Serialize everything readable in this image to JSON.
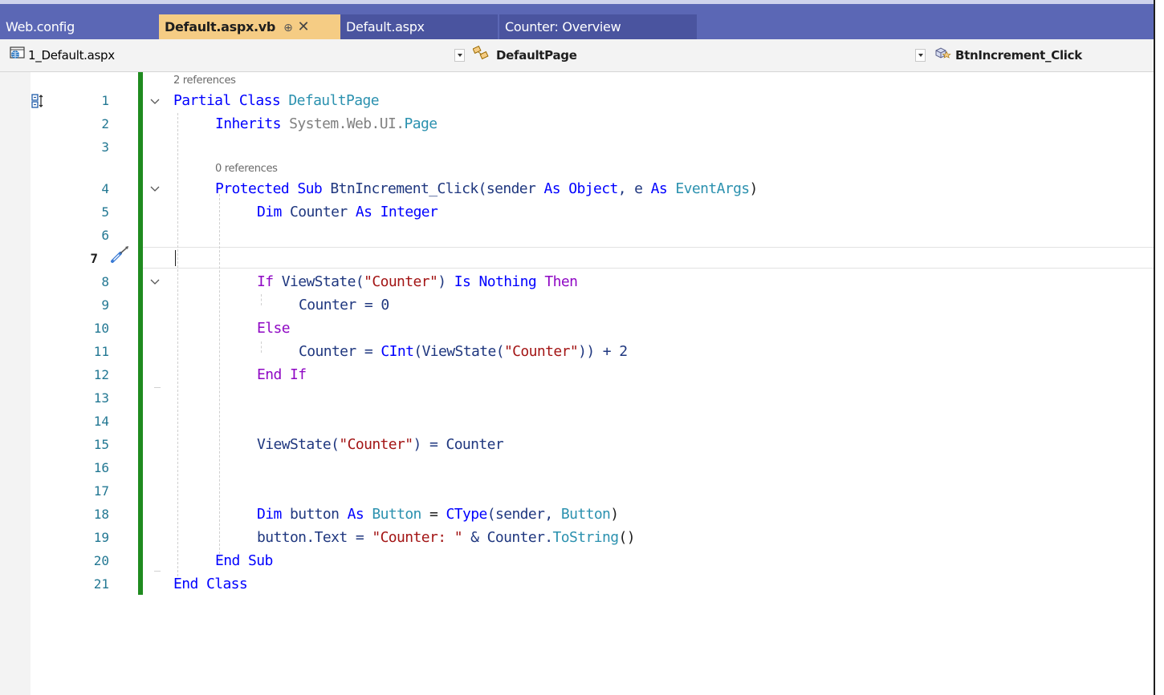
{
  "tabs": [
    {
      "label": "Web.config"
    },
    {
      "label": "Default.aspx.vb",
      "pin": "⊕",
      "close": "✕"
    },
    {
      "label": "Default.aspx"
    },
    {
      "label": "Counter: Overview"
    }
  ],
  "navbar": {
    "project": "1_Default.aspx",
    "class": "DefaultPage",
    "member": "BtnIncrement_Click"
  },
  "editor": {
    "current_line": "7",
    "codelens": {
      "class_refs": "2 references",
      "method_refs": "0 references"
    },
    "line_numbers": [
      "1",
      "2",
      "3",
      "4",
      "5",
      "6",
      "7",
      "8",
      "9",
      "10",
      "11",
      "12",
      "13",
      "14",
      "15",
      "16",
      "17",
      "18",
      "19",
      "20",
      "21"
    ],
    "lines": {
      "l1": {
        "kw1": "Partial",
        "kw2": "Class",
        "name": "DefaultPage"
      },
      "l2": {
        "kw": "Inherits",
        "ns": "System.Web.UI.",
        "type": "Page"
      },
      "l4": {
        "kw1": "Protected",
        "kw2": "Sub",
        "name": "BtnIncrement_Click(sender",
        "kw3": "As",
        "t1": "Object",
        "mid": ", e",
        "kw4": "As",
        "t2": "EventArgs",
        "end": ")"
      },
      "l5": {
        "kw1": "Dim",
        "name": "Counter",
        "kw2": "As",
        "type": "Integer"
      },
      "l8": {
        "kw1": "If",
        "expr": "ViewState(",
        "str": "\"Counter\"",
        "close": ")",
        "kw2": "Is",
        "kw3": "Nothing",
        "kw4": "Then"
      },
      "l9": {
        "text": "Counter = 0"
      },
      "l10": {
        "kw": "Else"
      },
      "l11": {
        "lhs": "Counter = ",
        "fn": "CInt",
        "mid": "(ViewState(",
        "str": "\"Counter\"",
        "end": ")) + 2"
      },
      "l12": {
        "kw1": "End",
        "kw2": "If"
      },
      "l15": {
        "lhs": "ViewState(",
        "str": "\"Counter\"",
        "end": ") = Counter"
      },
      "l18": {
        "kw1": "Dim",
        "name": "button",
        "kw2": "As",
        "t1": "Button",
        "eq": "=",
        "fn": "CType",
        "mid": "(sender, ",
        "t2": "Button",
        "end": ")"
      },
      "l19": {
        "lhs": "button.Text = ",
        "str": "\"Counter: \"",
        "amp": " & Counter.",
        "fn": "ToString",
        "end": "()"
      },
      "l20": {
        "kw1": "End",
        "kw2": "Sub"
      },
      "l21": {
        "kw1": "End",
        "kw2": "Class"
      }
    }
  },
  "colors": {
    "tabbar": "#5b67b5",
    "active_tab": "#f5cc84",
    "keyword": "#0000ff",
    "control_keyword": "#8f08c4",
    "type": "#2b91af",
    "string": "#a31515",
    "line_number": "#237893",
    "change_bar": "#1f8b1f"
  }
}
